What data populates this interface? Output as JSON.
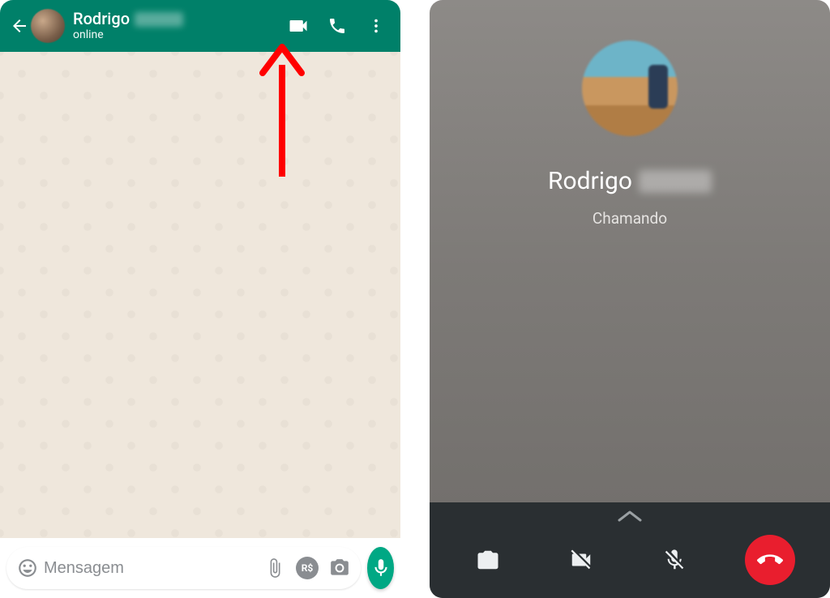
{
  "chat": {
    "contact_name": "Rodrigo",
    "contact_status": "online",
    "input_placeholder": "Mensagem",
    "payment_label": "R$"
  },
  "call": {
    "contact_name": "Rodrigo",
    "status": "Chamando"
  }
}
